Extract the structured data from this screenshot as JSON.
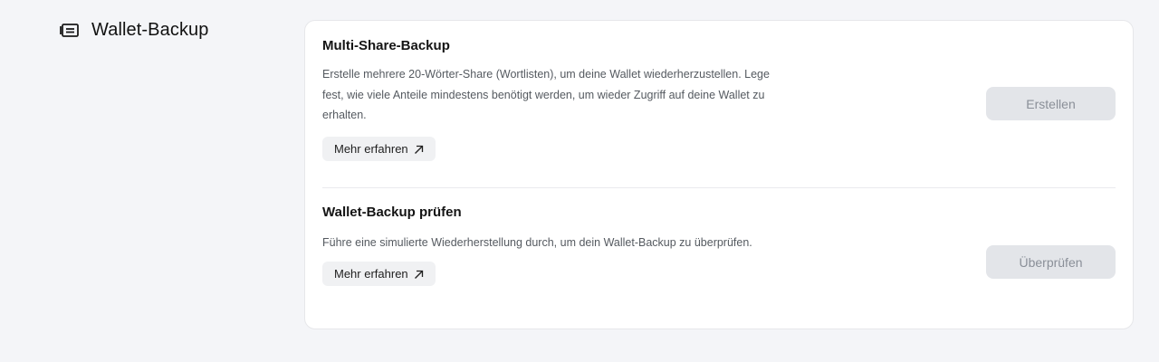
{
  "section": {
    "icon": "wallet-list-icon",
    "title": "Wallet-Backup"
  },
  "multi_share": {
    "title": "Multi-Share-Backup",
    "description": "Erstelle mehrere 20-Wörter-Share (Wortlisten), um deine Wallet wiederherzustellen. Lege fest, wie viele Anteile mindestens benötigt werden, um wieder Zugriff auf deine Wallet zu erhalten.",
    "more_label": "Mehr erfahren",
    "more_icon": "arrow-up-right-icon",
    "button_label": "Erstellen"
  },
  "verify_backup": {
    "title": "Wallet-Backup prüfen",
    "description": "Führe eine simulierte Wiederherstellung durch, um dein Wallet-Backup zu überprüfen.",
    "more_label": "Mehr erfahren",
    "more_icon": "arrow-up-right-icon",
    "button_label": "Überprüfen"
  },
  "colors": {
    "page_bg": "#f4f5f8",
    "card_bg": "#ffffff",
    "button_bg": "#e3e5e9",
    "button_text": "#8a8f98"
  }
}
